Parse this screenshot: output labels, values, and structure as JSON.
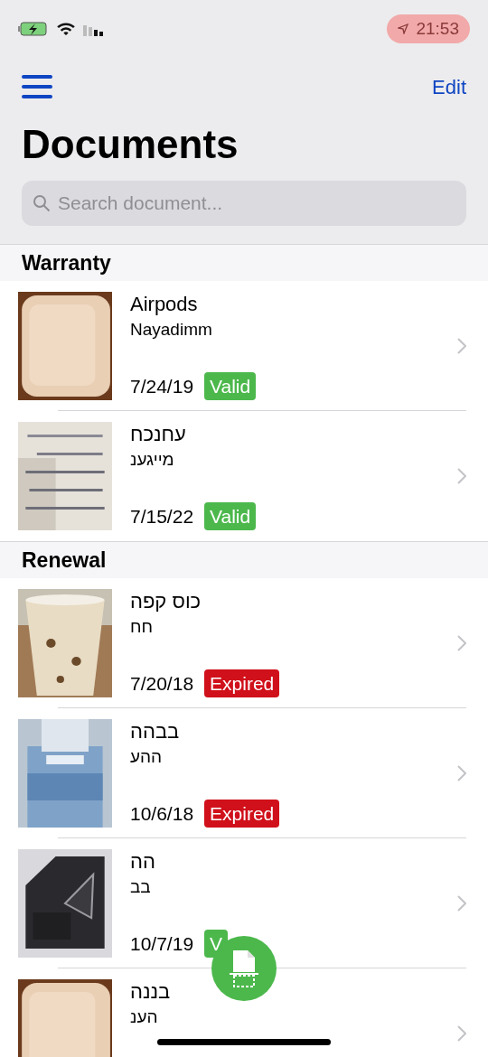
{
  "status_bar": {
    "time": "21:53"
  },
  "nav": {
    "edit": "Edit",
    "title": "Documents"
  },
  "search": {
    "placeholder": "Search document..."
  },
  "sections": [
    {
      "title": "Warranty",
      "items": [
        {
          "name": "Airpods",
          "store": "Nayadimm",
          "date": "7/24/19",
          "badge": "Valid",
          "kind": "valid"
        },
        {
          "name": "עחנכח",
          "store": "מייגענ",
          "date": "7/15/22",
          "badge": "Valid",
          "kind": "valid"
        }
      ]
    },
    {
      "title": "Renewal",
      "items": [
        {
          "name": "כוס קפה",
          "store": "חח",
          "date": "7/20/18",
          "badge": "Expired",
          "kind": "expired"
        },
        {
          "name": "בבהה",
          "store": "ההע",
          "date": "10/6/18",
          "badge": "Expired",
          "kind": "expired"
        },
        {
          "name": "הה",
          "store": "בב",
          "date": "10/7/19",
          "badge": "V",
          "kind": "valid"
        },
        {
          "name": "בננה",
          "store": "הענ"
        }
      ]
    }
  ]
}
